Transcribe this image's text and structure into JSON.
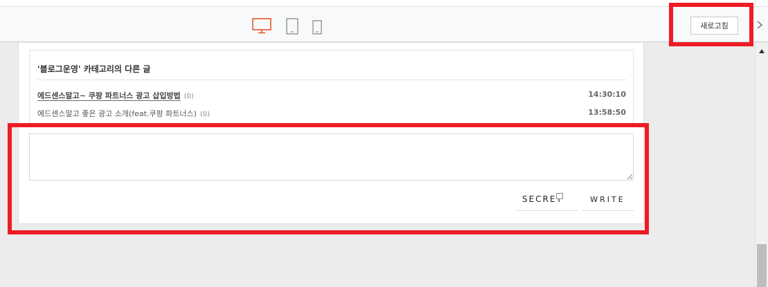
{
  "toolbar": {
    "refresh_label": "새로고침",
    "devices": [
      "desktop-icon",
      "tablet-icon",
      "mobile-icon"
    ],
    "active_device": "desktop"
  },
  "related": {
    "title": "'블로그운영' 카테고리의 다른 글",
    "items": [
      {
        "title": "에드센스말고~ 쿠팡 파트너스 광고 삽입방법",
        "count": "(0)",
        "time": "14:30:10"
      },
      {
        "title": "에드센스말고 좋은 광고 소개(feat.쿠팡 파트너스)",
        "count": "(0)",
        "time": "13:58:50"
      }
    ]
  },
  "comment": {
    "placeholder": "",
    "secret_label": "SECRET",
    "write_label": "WRITE"
  },
  "colors": {
    "accent": "#e8552a",
    "highlight": "#ee1c25"
  }
}
